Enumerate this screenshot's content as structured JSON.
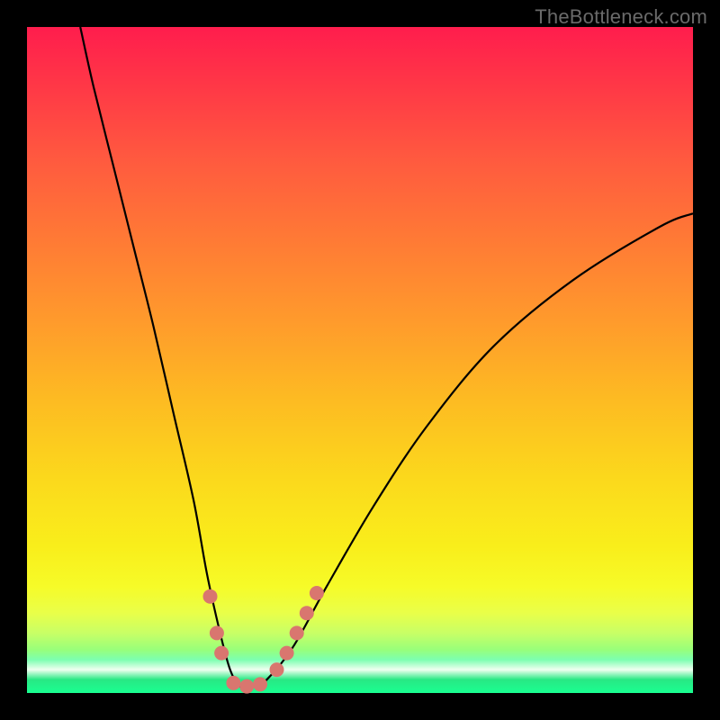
{
  "watermark": "TheBottleneck.com",
  "chart_data": {
    "type": "line",
    "title": "",
    "xlabel": "",
    "ylabel": "",
    "xlim": [
      0,
      100
    ],
    "ylim": [
      0,
      100
    ],
    "series": [
      {
        "name": "bottleneck-curve",
        "x": [
          8,
          10,
          13,
          16,
          19,
          22,
          25,
          27,
          29,
          30.5,
          32,
          34,
          36,
          40,
          45,
          52,
          60,
          70,
          82,
          95,
          100
        ],
        "y": [
          100,
          91,
          79,
          67,
          55,
          42,
          29,
          18,
          9,
          3.5,
          1,
          1,
          2,
          7,
          16,
          28,
          40,
          52,
          62,
          70,
          72
        ]
      }
    ],
    "markers": [
      {
        "name": "left-cluster-marker",
        "x": 27.5,
        "y": 14.5
      },
      {
        "name": "left-cluster-marker",
        "x": 28.5,
        "y": 9.0
      },
      {
        "name": "left-cluster-marker",
        "x": 29.2,
        "y": 6.0
      },
      {
        "name": "bottom-marker",
        "x": 31.0,
        "y": 1.5
      },
      {
        "name": "bottom-marker",
        "x": 33.0,
        "y": 1.0
      },
      {
        "name": "bottom-marker",
        "x": 35.0,
        "y": 1.3
      },
      {
        "name": "right-cluster-marker",
        "x": 37.5,
        "y": 3.5
      },
      {
        "name": "right-cluster-marker",
        "x": 39.0,
        "y": 6.0
      },
      {
        "name": "right-cluster-marker",
        "x": 40.5,
        "y": 9.0
      },
      {
        "name": "right-cluster-marker",
        "x": 42.0,
        "y": 12.0
      },
      {
        "name": "right-cluster-marker",
        "x": 43.5,
        "y": 15.0
      }
    ],
    "colors": {
      "curve": "#000000",
      "marker": "#d9766f",
      "top": "#ff1d4d",
      "mid": "#fdd81d",
      "bottom": "#1aff91"
    }
  }
}
